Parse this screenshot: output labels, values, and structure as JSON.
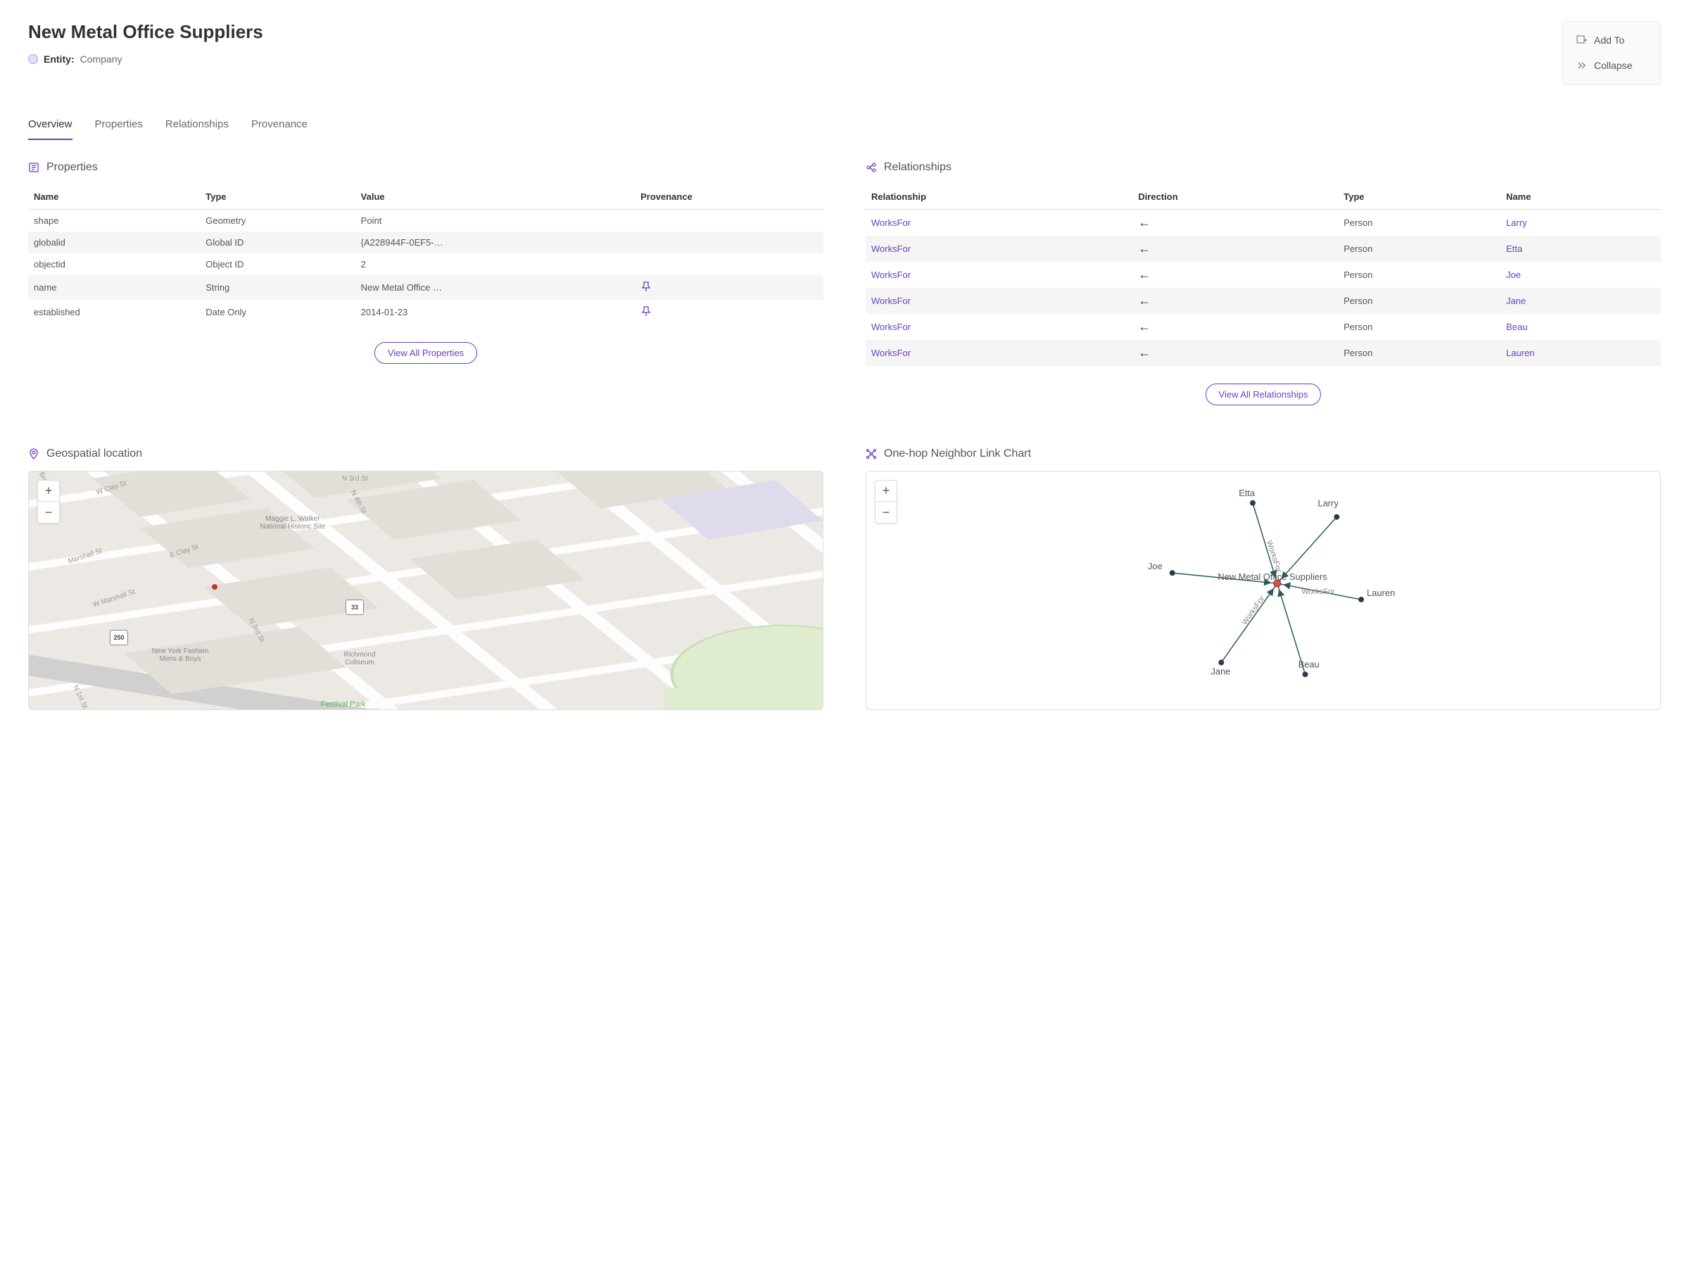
{
  "header": {
    "title": "New Metal Office Suppliers",
    "entity_label": "Entity:",
    "entity_type": "Company"
  },
  "actions": {
    "add_to": "Add To",
    "collapse": "Collapse"
  },
  "tabs": {
    "overview": "Overview",
    "properties": "Properties",
    "relationships": "Relationships",
    "provenance": "Provenance"
  },
  "properties_section": {
    "title": "Properties",
    "columns": {
      "name": "Name",
      "type": "Type",
      "value": "Value",
      "provenance": "Provenance"
    },
    "rows": [
      {
        "name": "shape",
        "type": "Geometry",
        "value": "Point",
        "has_pin": false
      },
      {
        "name": "globalid",
        "type": "Global ID",
        "value": "{A228944F-0EF5-…",
        "has_pin": false
      },
      {
        "name": "objectid",
        "type": "Object ID",
        "value": "2",
        "has_pin": false
      },
      {
        "name": "name",
        "type": "String",
        "value": "New Metal Office …",
        "has_pin": true
      },
      {
        "name": "established",
        "type": "Date Only",
        "value": "2014-01-23",
        "has_pin": true
      }
    ],
    "view_all": "View All Properties"
  },
  "relationships_section": {
    "title": "Relationships",
    "columns": {
      "relationship": "Relationship",
      "direction": "Direction",
      "type": "Type",
      "name": "Name"
    },
    "rows": [
      {
        "relationship": "WorksFor",
        "direction": "←",
        "type": "Person",
        "name": "Larry"
      },
      {
        "relationship": "WorksFor",
        "direction": "←",
        "type": "Person",
        "name": "Etta"
      },
      {
        "relationship": "WorksFor",
        "direction": "←",
        "type": "Person",
        "name": "Joe"
      },
      {
        "relationship": "WorksFor",
        "direction": "←",
        "type": "Person",
        "name": "Jane"
      },
      {
        "relationship": "WorksFor",
        "direction": "←",
        "type": "Person",
        "name": "Beau"
      },
      {
        "relationship": "WorksFor",
        "direction": "←",
        "type": "Person",
        "name": "Lauren"
      }
    ],
    "view_all": "View All Relationships"
  },
  "geo_section": {
    "title": "Geospatial location",
    "labels": {
      "w_clay": "W Clay St",
      "e_clay": "E Clay St",
      "w_marshall": "W Marshall St",
      "marshall": "Marshall St",
      "brook": "Brook Rd",
      "n_1st": "N 1st St",
      "n_3rd": "N 3rd St",
      "n_3rd_top": "N 3rd St",
      "n_4th": "N 4th St",
      "historic": "Maggie L. Walker National Historic Site",
      "fashion": "New York Fashion Mens & Boys",
      "coliseum": "Richmond Coliseum",
      "festival": "Festival Park",
      "route250": "250",
      "route33": "33"
    }
  },
  "link_chart_section": {
    "title": "One-hop Neighbor Link Chart",
    "center_label": "New Metal Office Suppliers",
    "edge_label": "WorksFor",
    "nodes": {
      "etta": "Etta",
      "larry": "Larry",
      "joe": "Joe",
      "lauren": "Lauren",
      "jane": "Jane",
      "beau": "Beau"
    }
  },
  "chart_data": {
    "type": "network",
    "center": "New Metal Office Suppliers",
    "edges": [
      {
        "from": "Etta",
        "to": "New Metal Office Suppliers",
        "label": "WorksFor"
      },
      {
        "from": "Larry",
        "to": "New Metal Office Suppliers",
        "label": "WorksFor"
      },
      {
        "from": "Joe",
        "to": "New Metal Office Suppliers",
        "label": "WorksFor"
      },
      {
        "from": "Lauren",
        "to": "New Metal Office Suppliers",
        "label": "WorksFor"
      },
      {
        "from": "Jane",
        "to": "New Metal Office Suppliers",
        "label": "WorksFor"
      },
      {
        "from": "Beau",
        "to": "New Metal Office Suppliers",
        "label": "WorksFor"
      }
    ]
  }
}
